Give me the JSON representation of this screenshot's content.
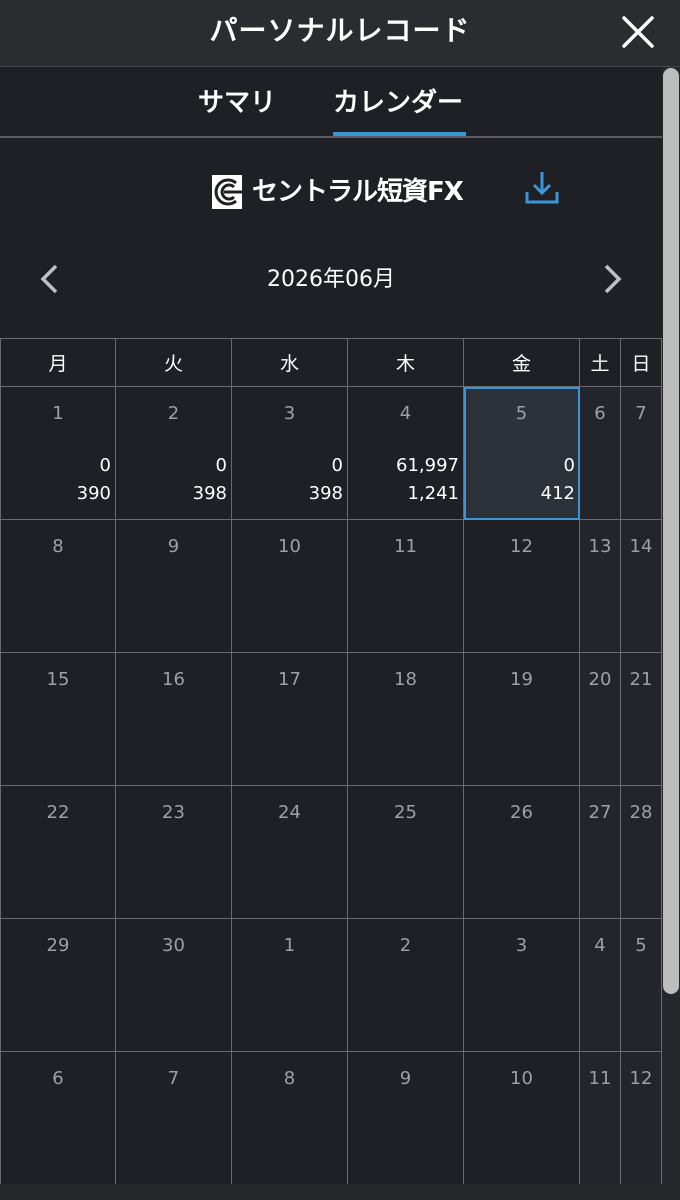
{
  "header": {
    "title": "パーソナルレコード",
    "close_icon": "close-icon"
  },
  "tabs": [
    {
      "label": "サマリ",
      "active": false
    },
    {
      "label": "カレンダー",
      "active": true
    }
  ],
  "brand": {
    "name": "セントラル短資FX",
    "logo_icon": "central-tanshi-logo"
  },
  "download_icon": "download-icon",
  "month_nav": {
    "label": "2026年06月",
    "prev_icon": "chevron-left-icon",
    "next_icon": "chevron-right-icon"
  },
  "colors": {
    "accent": "#3a96d6",
    "background": "#1e2025",
    "header": "#2b2c30"
  },
  "calendar": {
    "weekdays": [
      "月",
      "火",
      "水",
      "木",
      "金",
      "土",
      "日"
    ],
    "weeks": [
      [
        {
          "day": "1",
          "v1": "0",
          "v2": "390"
        },
        {
          "day": "2",
          "v1": "0",
          "v2": "398"
        },
        {
          "day": "3",
          "v1": "0",
          "v2": "398"
        },
        {
          "day": "4",
          "v1": "61,997",
          "v2": "1,241"
        },
        {
          "day": "5",
          "v1": "0",
          "v2": "412",
          "selected": true
        },
        {
          "day": "6"
        },
        {
          "day": "7"
        }
      ],
      [
        {
          "day": "8"
        },
        {
          "day": "9"
        },
        {
          "day": "10"
        },
        {
          "day": "11"
        },
        {
          "day": "12"
        },
        {
          "day": "13"
        },
        {
          "day": "14"
        }
      ],
      [
        {
          "day": "15"
        },
        {
          "day": "16"
        },
        {
          "day": "17"
        },
        {
          "day": "18"
        },
        {
          "day": "19"
        },
        {
          "day": "20"
        },
        {
          "day": "21"
        }
      ],
      [
        {
          "day": "22"
        },
        {
          "day": "23"
        },
        {
          "day": "24"
        },
        {
          "day": "25"
        },
        {
          "day": "26"
        },
        {
          "day": "27"
        },
        {
          "day": "28"
        }
      ],
      [
        {
          "day": "29"
        },
        {
          "day": "30"
        },
        {
          "day": "1"
        },
        {
          "day": "2"
        },
        {
          "day": "3"
        },
        {
          "day": "4"
        },
        {
          "day": "5"
        }
      ],
      [
        {
          "day": "6"
        },
        {
          "day": "7"
        },
        {
          "day": "8"
        },
        {
          "day": "9"
        },
        {
          "day": "10"
        },
        {
          "day": "11"
        },
        {
          "day": "12"
        }
      ]
    ]
  }
}
